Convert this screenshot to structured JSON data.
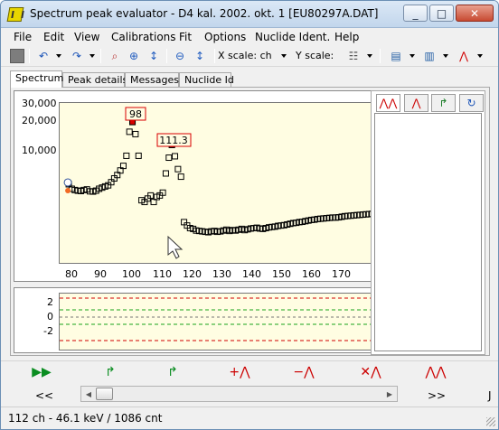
{
  "window": {
    "title": "Spectrum peak evaluator - D4 kal. 2002. okt. 1 [EU80297A.DAT]",
    "buttons": [
      "_",
      "□",
      "✕"
    ]
  },
  "menu": [
    "File",
    "Edit",
    "View",
    "Calibrations",
    "Fit",
    "Options",
    "Nuclide Ident.",
    "Help"
  ],
  "toolbar": {
    "x_scale_label": "X scale: ch",
    "y_scale_label": "Y scale:"
  },
  "tabs": [
    "Spectrum",
    "Peak details",
    "Messages",
    "Nuclide Id"
  ],
  "spectrum": {
    "y_ticks": [
      "30,000",
      "20,000",
      "10,000"
    ],
    "x_ticks": [
      "80",
      "90",
      "100",
      "110",
      "120",
      "130",
      "140",
      "150",
      "160",
      "170"
    ],
    "peak_labels": [
      "98",
      "111.3"
    ],
    "residual_ticks": [
      "2",
      "0",
      "-2"
    ]
  },
  "chart_data": {
    "type": "scatter",
    "title": "",
    "xlabel": "",
    "ylabel": "",
    "x": [
      77,
      78,
      79,
      80,
      81,
      82,
      83,
      84,
      85,
      86,
      87,
      88,
      89,
      90,
      91,
      92,
      93,
      94,
      95,
      96,
      97,
      98,
      99,
      100,
      101,
      102,
      103,
      104,
      105,
      106,
      107,
      108,
      109,
      110,
      111,
      112,
      113,
      114,
      115,
      116,
      117,
      118,
      119,
      120,
      121,
      122,
      123,
      124,
      125,
      126,
      127,
      128,
      129,
      130,
      131,
      132,
      133,
      134,
      135,
      136,
      137,
      138,
      139,
      140,
      141,
      142,
      143,
      144,
      145,
      146,
      147,
      148,
      149,
      150,
      151,
      152,
      153,
      154,
      155,
      156,
      157,
      158,
      159,
      160,
      161,
      162,
      163,
      164,
      165,
      166,
      167,
      168,
      169,
      170,
      171,
      172,
      173,
      174,
      175,
      176,
      177,
      178
    ],
    "y": [
      3200,
      2800,
      2700,
      2650,
      2620,
      2700,
      2750,
      2600,
      2580,
      2650,
      2800,
      2900,
      3000,
      3100,
      3400,
      3800,
      4200,
      4800,
      5500,
      7400,
      15000,
      20000,
      14000,
      7400,
      2000,
      1900,
      2100,
      2300,
      1900,
      2200,
      2300,
      2500,
      4400,
      7000,
      10200,
      7300,
      5000,
      4000,
      1050,
      950,
      880,
      860,
      820,
      810,
      800,
      790,
      780,
      800,
      810,
      790,
      800,
      820,
      840,
      810,
      830,
      820,
      840,
      860,
      830,
      850,
      870,
      880,
      890,
      870,
      860,
      880,
      900,
      910,
      920,
      940,
      950,
      960,
      980,
      1000,
      1020,
      1030,
      1050,
      1060,
      1080,
      1100,
      1120,
      1130,
      1150,
      1160,
      1170,
      1180,
      1190,
      1200,
      1200,
      1210,
      1230,
      1250,
      1260,
      1270,
      1280,
      1290,
      1300,
      1310,
      1320,
      1330,
      1340,
      1360
    ],
    "xlim": [
      74,
      178
    ],
    "ylim": [
      300,
      35000
    ],
    "y_scale": "log",
    "grid": false
  },
  "side": {
    "tabs": [
      "peaks",
      "single-peak",
      "fit",
      "history"
    ]
  },
  "bottom": {
    "nav_left": "<<",
    "nav_right": ">>",
    "nav_extra": "J"
  },
  "status": {
    "text": "112 ch - 46.1 keV / 1086 cnt"
  },
  "colors": {
    "plot_bg": "#fffde2",
    "peak_marker": "#d80000",
    "residual_red": "#d00000",
    "residual_green": "#19a319",
    "accent": "#1f5bbf"
  }
}
